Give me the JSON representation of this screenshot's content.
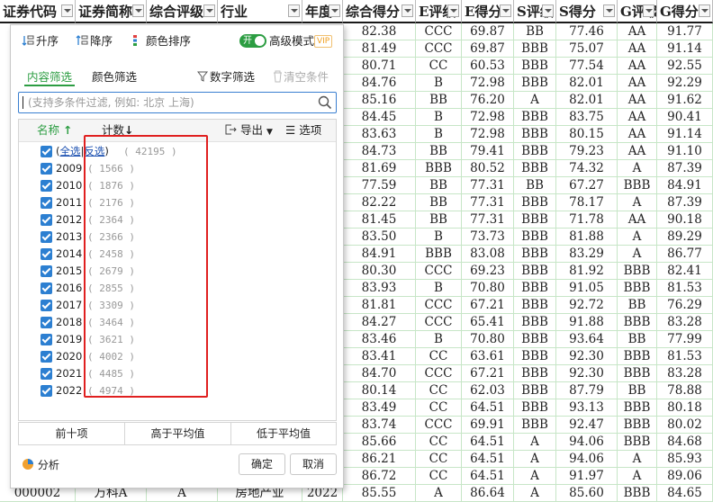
{
  "sheet": {
    "headers": [
      "证券代码",
      "证券简称",
      "综合评级",
      "行业",
      "年度",
      "综合得分",
      "E评级",
      "E得分",
      "S评级",
      "S得分",
      "G评级",
      "G得分"
    ],
    "rows": [
      [
        "82.38",
        "CCC",
        "69.87",
        "BB",
        "77.46",
        "AA",
        "91.77"
      ],
      [
        "81.49",
        "CCC",
        "69.87",
        "BBB",
        "75.07",
        "AA",
        "91.14"
      ],
      [
        "80.71",
        "CC",
        "60.53",
        "BBB",
        "77.54",
        "AA",
        "92.55"
      ],
      [
        "84.76",
        "B",
        "72.98",
        "BBB",
        "82.01",
        "AA",
        "92.29"
      ],
      [
        "85.16",
        "BB",
        "76.20",
        "A",
        "82.01",
        "AA",
        "91.62"
      ],
      [
        "84.45",
        "B",
        "72.98",
        "BBB",
        "83.75",
        "AA",
        "90.41"
      ],
      [
        "83.63",
        "B",
        "72.98",
        "BBB",
        "80.15",
        "AA",
        "91.14"
      ],
      [
        "84.73",
        "BB",
        "79.41",
        "BBB",
        "79.23",
        "AA",
        "91.10"
      ],
      [
        "81.69",
        "BBB",
        "80.52",
        "BBB",
        "74.32",
        "A",
        "87.39"
      ],
      [
        "77.59",
        "BB",
        "77.31",
        "BB",
        "67.27",
        "BBB",
        "84.91"
      ],
      [
        "82.22",
        "BB",
        "77.31",
        "BBB",
        "78.17",
        "A",
        "87.39"
      ],
      [
        "81.45",
        "BB",
        "77.31",
        "BBB",
        "71.78",
        "AA",
        "90.18"
      ],
      [
        "83.50",
        "B",
        "73.73",
        "BBB",
        "81.88",
        "A",
        "89.29"
      ],
      [
        "84.91",
        "BBB",
        "83.08",
        "BBB",
        "83.29",
        "A",
        "86.77"
      ],
      [
        "80.30",
        "CCC",
        "69.23",
        "BBB",
        "81.92",
        "BBB",
        "82.41"
      ],
      [
        "83.93",
        "B",
        "70.80",
        "BBB",
        "91.05",
        "BBB",
        "81.53"
      ],
      [
        "81.81",
        "CCC",
        "67.21",
        "BBB",
        "92.72",
        "BB",
        "76.29"
      ],
      [
        "84.27",
        "CCC",
        "65.41",
        "BBB",
        "91.88",
        "BBB",
        "83.28"
      ],
      [
        "83.46",
        "B",
        "70.80",
        "BBB",
        "93.64",
        "BB",
        "77.99"
      ],
      [
        "83.41",
        "CC",
        "63.61",
        "BBB",
        "92.30",
        "BBB",
        "81.53"
      ],
      [
        "84.70",
        "CCC",
        "67.21",
        "BBB",
        "92.30",
        "BBB",
        "83.28"
      ],
      [
        "80.14",
        "CC",
        "62.03",
        "BBB",
        "87.79",
        "BB",
        "78.88"
      ],
      [
        "83.49",
        "CC",
        "64.51",
        "BBB",
        "93.13",
        "BBB",
        "80.18"
      ],
      [
        "83.74",
        "CCC",
        "69.91",
        "BBB",
        "92.47",
        "BBB",
        "80.02"
      ],
      [
        "85.66",
        "CC",
        "64.51",
        "A",
        "94.06",
        "BBB",
        "84.68"
      ],
      [
        "86.21",
        "CC",
        "64.51",
        "A",
        "94.06",
        "A",
        "85.93"
      ],
      [
        "86.72",
        "CC",
        "64.51",
        "A",
        "91.97",
        "A",
        "89.06"
      ]
    ],
    "last_row": [
      "000002",
      "万科A",
      "A",
      "房地产业",
      "2022",
      "85.55",
      "A",
      "86.64",
      "A",
      "85.60",
      "BBB",
      "84.65"
    ]
  },
  "panel": {
    "toolbar": {
      "asc": "升序",
      "desc": "降序",
      "color_sort": "颜色排序",
      "toggle_on": "开",
      "advanced": "高级模式",
      "vip": "VIP"
    },
    "tabs": {
      "content": "内容筛选",
      "color": "颜色筛选"
    },
    "number_filter": "数字筛选",
    "clear": "清空条件",
    "search_placeholder": "(支持多条件过滤, 例如: 北京 上海)",
    "list_header": {
      "name": "名称",
      "count": "计数",
      "export": "导出",
      "options": "选项"
    },
    "select_all": {
      "all": "全选",
      "invert": "反选",
      "count": "( 42195 )"
    },
    "items": [
      {
        "label": "2009",
        "count": "( 1566 )"
      },
      {
        "label": "2010",
        "count": "( 1876 )"
      },
      {
        "label": "2011",
        "count": "( 2176 )"
      },
      {
        "label": "2012",
        "count": "( 2364 )"
      },
      {
        "label": "2013",
        "count": "( 2366 )"
      },
      {
        "label": "2014",
        "count": "( 2458 )"
      },
      {
        "label": "2015",
        "count": "( 2679 )"
      },
      {
        "label": "2016",
        "count": "( 2855 )"
      },
      {
        "label": "2017",
        "count": "( 3309 )"
      },
      {
        "label": "2018",
        "count": "( 3464 )"
      },
      {
        "label": "2019",
        "count": "( 3621 )"
      },
      {
        "label": "2020",
        "count": "( 4002 )"
      },
      {
        "label": "2021",
        "count": "( 4485 )"
      },
      {
        "label": "2022",
        "count": "( 4974 )"
      }
    ],
    "buttons": {
      "top10": "前十项",
      "above_avg": "高于平均值",
      "below_avg": "低于平均值"
    },
    "analyze": "分析",
    "ok": "确定",
    "cancel": "取消"
  }
}
